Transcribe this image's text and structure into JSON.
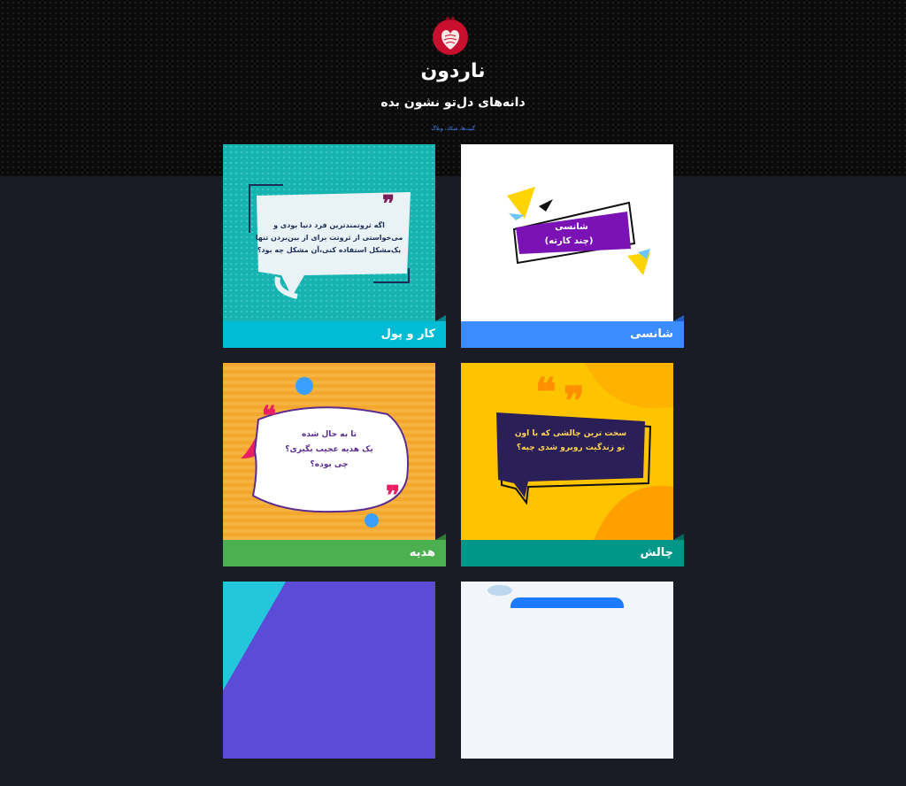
{
  "site": {
    "brand": "ناردون",
    "tagline": "دانه‌های دل‌تو نشون بده",
    "nav_links": "گیت‌ها، شکاد، وبلاگ",
    "logo_icon": "pomegranate-heart-icon"
  },
  "cards": [
    {
      "label": "شانسی",
      "thumb_text_1": "شانسی",
      "thumb_text_2": "(چند کارته)",
      "bar_color": "#3a8cff"
    },
    {
      "label": "کار و پول",
      "thumb_line_1": "اگه ثروتمندترین فرد دنیا بودی و",
      "thumb_line_2": "می‌خواستی از ثروتت برای از بین‌بردن تنها",
      "thumb_line_3": "یک‌مشکل استفاده کنی،آن مشکل چه بود؟",
      "bar_color": "#00bcd4"
    },
    {
      "label": "چالش",
      "thumb_line_1": "سخت ترین چالشی که با اون",
      "thumb_line_2": "تو زندگیت روبرو شدی چیه؟",
      "bar_color": "#009688"
    },
    {
      "label": "هدیه",
      "thumb_line_1": "تا به حال شده",
      "thumb_line_2": "یک هدیه عجیب بگیری؟",
      "thumb_line_3": "چی بوده؟",
      "bar_color": "#4caf50"
    }
  ]
}
